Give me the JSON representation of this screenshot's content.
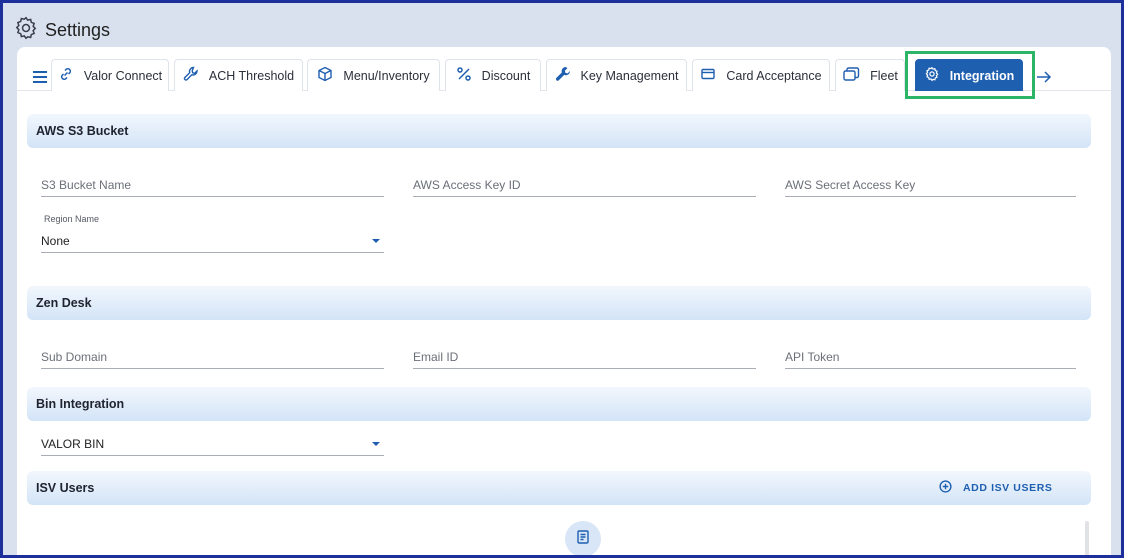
{
  "app": {
    "title": "Settings"
  },
  "tabs": [
    {
      "label": "Valor Connect"
    },
    {
      "label": "ACH Threshold"
    },
    {
      "label": "Menu/Inventory"
    },
    {
      "label": "Discount"
    },
    {
      "label": "Key Management"
    },
    {
      "label": "Card Acceptance"
    },
    {
      "label": "Fleet"
    },
    {
      "label": "Integration",
      "active": true
    }
  ],
  "aws": {
    "heading": "AWS S3 Bucket",
    "bucket_name_placeholder": "S3 Bucket Name",
    "access_key_placeholder": "AWS Access Key ID",
    "secret_key_placeholder": "AWS Secret Access Key",
    "region_label": "Region Name",
    "region_value": "None"
  },
  "zendesk": {
    "heading": "Zen Desk",
    "subdomain_placeholder": "Sub Domain",
    "email_placeholder": "Email ID",
    "token_placeholder": "API Token"
  },
  "bin": {
    "heading": "Bin Integration",
    "selected": "VALOR BIN"
  },
  "isv": {
    "heading": "ISV Users",
    "add_label": "ADD ISV USERS"
  },
  "colors": {
    "accent": "#1f5fb0",
    "highlight": "#2cb567",
    "frame": "#1d2f9a"
  }
}
